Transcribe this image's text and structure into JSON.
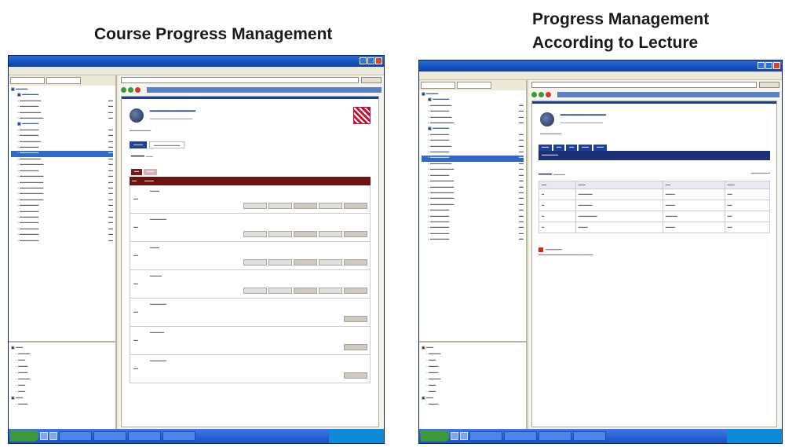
{
  "captions": {
    "left": "Course Progress Management",
    "right_line1": "Progress Management",
    "right_line2": "According to Lecture"
  },
  "colors": {
    "titlebar": "#0b3fa8",
    "grid_header": "#6e1111",
    "tab_active": "#1c3f98",
    "taskbar": "#1b4fc2"
  },
  "icons": [
    "window-minimize-icon",
    "window-maximize-icon",
    "window-close-icon",
    "back-icon",
    "forward-icon",
    "stop-icon",
    "folder-icon",
    "university-logo-icon"
  ]
}
